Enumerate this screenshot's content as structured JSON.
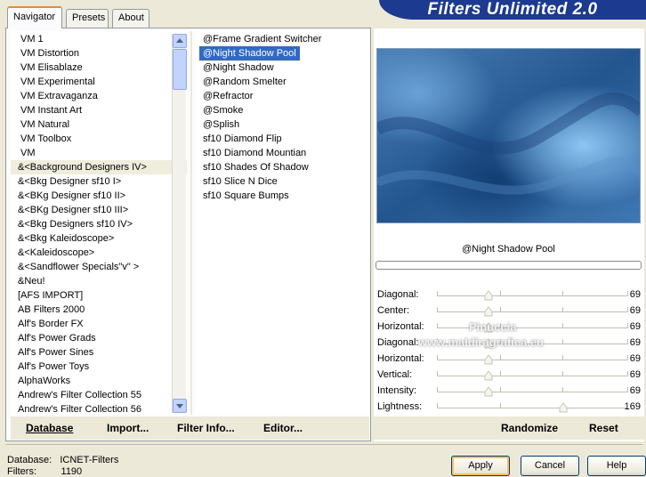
{
  "title": "Filters Unlimited 2.0",
  "tabs": [
    {
      "label": "Navigator",
      "active": true
    },
    {
      "label": "Presets",
      "active": false
    },
    {
      "label": "About",
      "active": false
    }
  ],
  "categories": [
    "VM 1",
    "VM Distortion",
    "VM Elisablaze",
    "VM Experimental",
    "VM Extravaganza",
    "VM Instant Art",
    "VM Natural",
    "VM Toolbox",
    "VM",
    "&<Background Designers IV>",
    "&<Bkg Designer sf10 I>",
    "&<BKg Designer sf10 II>",
    "&<BKg Designer sf10 III>",
    "&<Bkg Designers sf10 IV>",
    "&<Bkg Kaleidoscope>",
    "&<Kaleidoscope>",
    "&<Sandflower Specials\"v\" >",
    "&Neu!",
    "[AFS IMPORT]",
    "AB Filters 2000",
    "Alf's Border FX",
    "Alf's Power Grads",
    "Alf's Power Sines",
    "Alf's Power Toys",
    "AlphaWorks",
    "Andrew's Filter Collection 55",
    "Andrew's Filter Collection 56"
  ],
  "categories_highlighted_index": 9,
  "filters": [
    "@Frame Gradient Switcher",
    "@Night Shadow Pool",
    "@Night Shadow",
    "@Random Smelter",
    "@Refractor",
    "@Smoke",
    "@Splish",
    "sf10 Diamond Flip",
    "sf10 Diamond Mountian",
    "sf10 Shades Of Shadow",
    "sf10 Slice N Dice",
    "sf10 Square Bumps"
  ],
  "filters_selected_index": 1,
  "left_buttons": {
    "database": "Database",
    "import": "Import...",
    "filter_info": "Filter Info...",
    "editor": "Editor..."
  },
  "preview": {
    "filter_name": "@Night Shadow Pool",
    "progress": 0
  },
  "sliders": [
    {
      "label": "Diagonal:",
      "value": "69"
    },
    {
      "label": "Center:",
      "value": "69"
    },
    {
      "label": "Horizontal:",
      "value": "69"
    },
    {
      "label": "Diagonal:",
      "value": "69"
    },
    {
      "label": "Horizontal:",
      "value": "69"
    },
    {
      "label": "Vertical:",
      "value": "69"
    },
    {
      "label": "Intensity:",
      "value": "69"
    },
    {
      "label": "Lightness:",
      "value": "169"
    }
  ],
  "watermark": {
    "line1": "Pinuccia",
    "line2": "www.maldiragrafica.eu"
  },
  "right_buttons": {
    "randomize": "Randomize",
    "reset": "Reset"
  },
  "footer": {
    "database_label": "Database:",
    "database_value": "ICNET-Filters",
    "filters_label": "Filters:",
    "filters_value": "1190"
  },
  "dialog_buttons": {
    "apply": "Apply",
    "cancel": "Cancel",
    "help": "Help"
  },
  "colors": {
    "banner": "#1c3a8f",
    "selection": "#316ac5",
    "tab_accent": "#e68b2c"
  }
}
